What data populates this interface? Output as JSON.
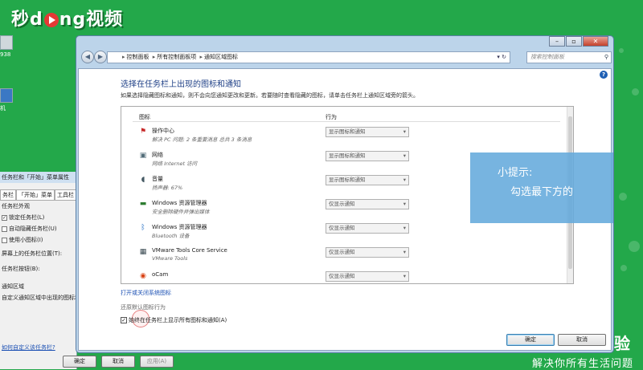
{
  "watermark": {
    "logo_pre": "秒",
    "logo_mid": "d",
    "logo_post": "ng视频",
    "tagline": "解决你所有生活问题",
    "side_text": "验"
  },
  "desktop": {
    "icon1_label": "938",
    "icon2_label": "机"
  },
  "taskbar_props": {
    "title": "任务栏和「开始」菜单属性",
    "tabs": [
      "务栏",
      "「开始」菜单",
      "工具栏"
    ],
    "section1": "任务栏外观",
    "options": [
      {
        "label": "锁定任务栏(L)",
        "checked": true
      },
      {
        "label": "自动隐藏任务栏(U)",
        "checked": false
      },
      {
        "label": "使用小图标(I)",
        "checked": false
      }
    ],
    "position_label": "屏幕上的任务栏位置(T):",
    "buttons_label": "任务栏按钮(B):",
    "section2": "通知区域",
    "notify_desc": "自定义通知区域中出现的图标和",
    "link": "如何自定义该任务栏?",
    "btn_ok": "确定",
    "btn_cancel": "取消",
    "btn_apply": "应用(A)"
  },
  "window": {
    "address": {
      "crumbs": [
        "控制面板",
        "所有控制面板项",
        "通知区域图标"
      ]
    },
    "search_placeholder": "搜索控制面板",
    "heading": "选择在任务栏上出现的图标和通知",
    "description": "如果选择隐藏图标和通知，则不会向您通知更改和更新。若要随时查看隐藏的图标，请单击任务栏上通知区域旁的箭头。",
    "col_icon": "图标",
    "col_behavior": "行为",
    "items": [
      {
        "name": "操作中心",
        "sub": "解决 PC 问题: 2 条重要消息 总共 3 条消息",
        "behavior": "显示图标和通知",
        "icon": "⚑"
      },
      {
        "name": "网络",
        "sub": "网络 Internet 访问",
        "behavior": "显示图标和通知",
        "icon": "▣"
      },
      {
        "name": "音量",
        "sub": "扬声器: 67%",
        "behavior": "显示图标和通知",
        "icon": "◖"
      },
      {
        "name": "Windows 资源管理器",
        "sub": "安全删除硬件并弹出媒体",
        "behavior": "仅显示通知",
        "icon": "▬"
      },
      {
        "name": "Windows 资源管理器",
        "sub": "Bluetooth 设备",
        "behavior": "仅显示通知",
        "icon": "ᛒ"
      },
      {
        "name": "VMware Tools Core Service",
        "sub": "VMware Tools",
        "behavior": "仅显示通知",
        "icon": "▦"
      },
      {
        "name": "oCam",
        "sub": "",
        "behavior": "仅显示通知",
        "icon": "◉"
      }
    ],
    "link_system_icons": "打开或关闭系统图标",
    "restore_default": "还原默认图标行为",
    "always_show_label": "始终在任务栏上显示所有图标和通知(A)",
    "always_show_checked": true,
    "ok_label": "确定",
    "cancel_label": "取消"
  },
  "tip": {
    "title": "小提示:",
    "body": "勾选最下方的"
  }
}
